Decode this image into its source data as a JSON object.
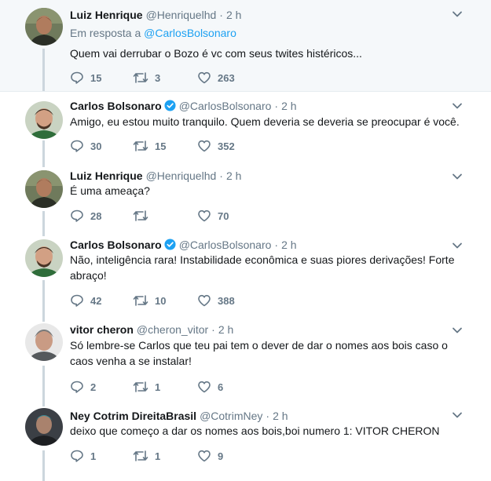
{
  "colors": {
    "link": "#1da1f2",
    "muted": "#657786",
    "text": "#14171a",
    "thread_line": "#ccd6dd",
    "highlight_bg": "#f5f8fa",
    "verified": "#1da1f2"
  },
  "tweets": [
    {
      "name": "Luiz Henrique",
      "handle": "@Henriquelhd",
      "separator": "·",
      "time": "2 h",
      "reply_prefix": "Em resposta a",
      "reply_handle": "@CarlosBolsonaro",
      "text": "Quem vai derrubar o Bozo é vc com seus twites histéricos...",
      "replies": "15",
      "retweets": "3",
      "likes": "263"
    },
    {
      "name": "Carlos Bolsonaro",
      "verified": true,
      "handle": "@CarlosBolsonaro",
      "separator": "·",
      "time": "2 h",
      "text": "Amigo, eu estou muito tranquilo. Quem deveria se deveria se preocupar é você.",
      "replies": "30",
      "retweets": "15",
      "likes": "352"
    },
    {
      "name": "Luiz Henrique",
      "handle": "@Henriquelhd",
      "separator": "·",
      "time": "2 h",
      "text": "É uma ameaça?",
      "replies": "28",
      "retweets": "",
      "likes": "70"
    },
    {
      "name": "Carlos Bolsonaro",
      "verified": true,
      "handle": "@CarlosBolsonaro",
      "separator": "·",
      "time": "2 h",
      "text": "Não, inteligência rara! Instabilidade econômica e suas piores derivações! Forte abraço!",
      "replies": "42",
      "retweets": "10",
      "likes": "388"
    },
    {
      "name": "vitor cheron",
      "handle": "@cheron_vitor",
      "separator": "·",
      "time": "2 h",
      "text": "Só lembre-se Carlos que teu pai tem o dever de dar o nomes aos bois caso o caos venha a se instalar!",
      "replies": "2",
      "retweets": "1",
      "likes": "6"
    },
    {
      "name": "Ney Cotrim DireitaBrasil",
      "handle": "@CotrimNey",
      "separator": "·",
      "time": "2 h",
      "text": "deixo que começo a dar os nomes aos bois,boi numero 1: VITOR CHERON",
      "replies": "1",
      "retweets": "1",
      "likes": "9"
    }
  ]
}
